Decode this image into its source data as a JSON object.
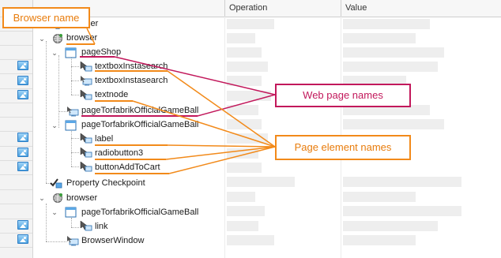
{
  "header": {
    "operation_label": "Operation",
    "value_label": "Value"
  },
  "tree": {
    "row0_text": "Browser",
    "row1_text": "browser",
    "row2_text": "pageShop",
    "row3_text": "textboxInstasearch",
    "row4_text": "textboxInstasearch",
    "row5_text": "textnode",
    "row6_text": "pageTorfabrikOfficialGameBall",
    "row7_text": "pageTorfabrikOfficialGameBall",
    "row8_text": "label",
    "row9_text": "radiobutton3",
    "row10_text": "buttonAddToCart",
    "row11_text": "Property Checkpoint",
    "row12_text": "browser",
    "row13_text": "pageTorfabrikOfficialGameBall",
    "row14_text": "link",
    "row15_text": "BrowserWindow"
  },
  "annotations": {
    "browser_name": "Browser name",
    "web_page_names": "Web page names",
    "page_element_names": "Page element names"
  },
  "colors": {
    "orange": "#f28a1a",
    "crimson": "#c2185b"
  }
}
